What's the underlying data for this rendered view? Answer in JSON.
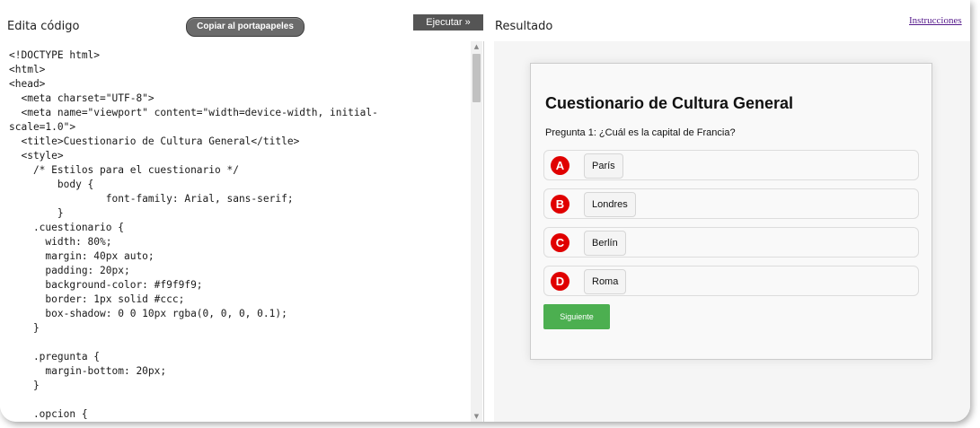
{
  "header": {
    "editor_title": "Edita código",
    "copy_label": "Copiar al portapapeles",
    "run_label": "Ejecutar »",
    "result_title": "Resultado",
    "instructions_link": "Instrucciones"
  },
  "editor": {
    "lines": [
      "<!DOCTYPE html>",
      "<html>",
      "<head>",
      "  <meta charset=\"UTF-8\">",
      "  <meta name=\"viewport\" content=\"width=device-width, initial-",
      "scale=1.0\">",
      "  <title>Cuestionario de Cultura General</title>",
      "  <style>",
      "    /* Estilos para el cuestionario */",
      "        body {",
      "                font-family: Arial, sans-serif;",
      "        }",
      "    .cuestionario {",
      "      width: 80%;",
      "      margin: 40px auto;",
      "      padding: 20px;",
      "      background-color: #f9f9f9;",
      "      border: 1px solid #ccc;",
      "      box-shadow: 0 0 10px rgba(0, 0, 0, 0.1);",
      "    }",
      "",
      "    .pregunta {",
      "      margin-bottom: 20px;",
      "    }",
      "",
      "    .opcion {"
    ]
  },
  "quiz": {
    "title": "Cuestionario de Cultura General",
    "question": "Pregunta 1: ¿Cuál es la capital de Francia?",
    "options": [
      {
        "letter": "A",
        "text": "París"
      },
      {
        "letter": "B",
        "text": "Londres"
      },
      {
        "letter": "C",
        "text": "Berlín"
      },
      {
        "letter": "D",
        "text": "Roma"
      }
    ],
    "next_label": "Siguiente"
  },
  "colors": {
    "badge": "#e00000",
    "next_button": "#4caf50",
    "run_button": "#555555",
    "link": "#551a8b"
  }
}
